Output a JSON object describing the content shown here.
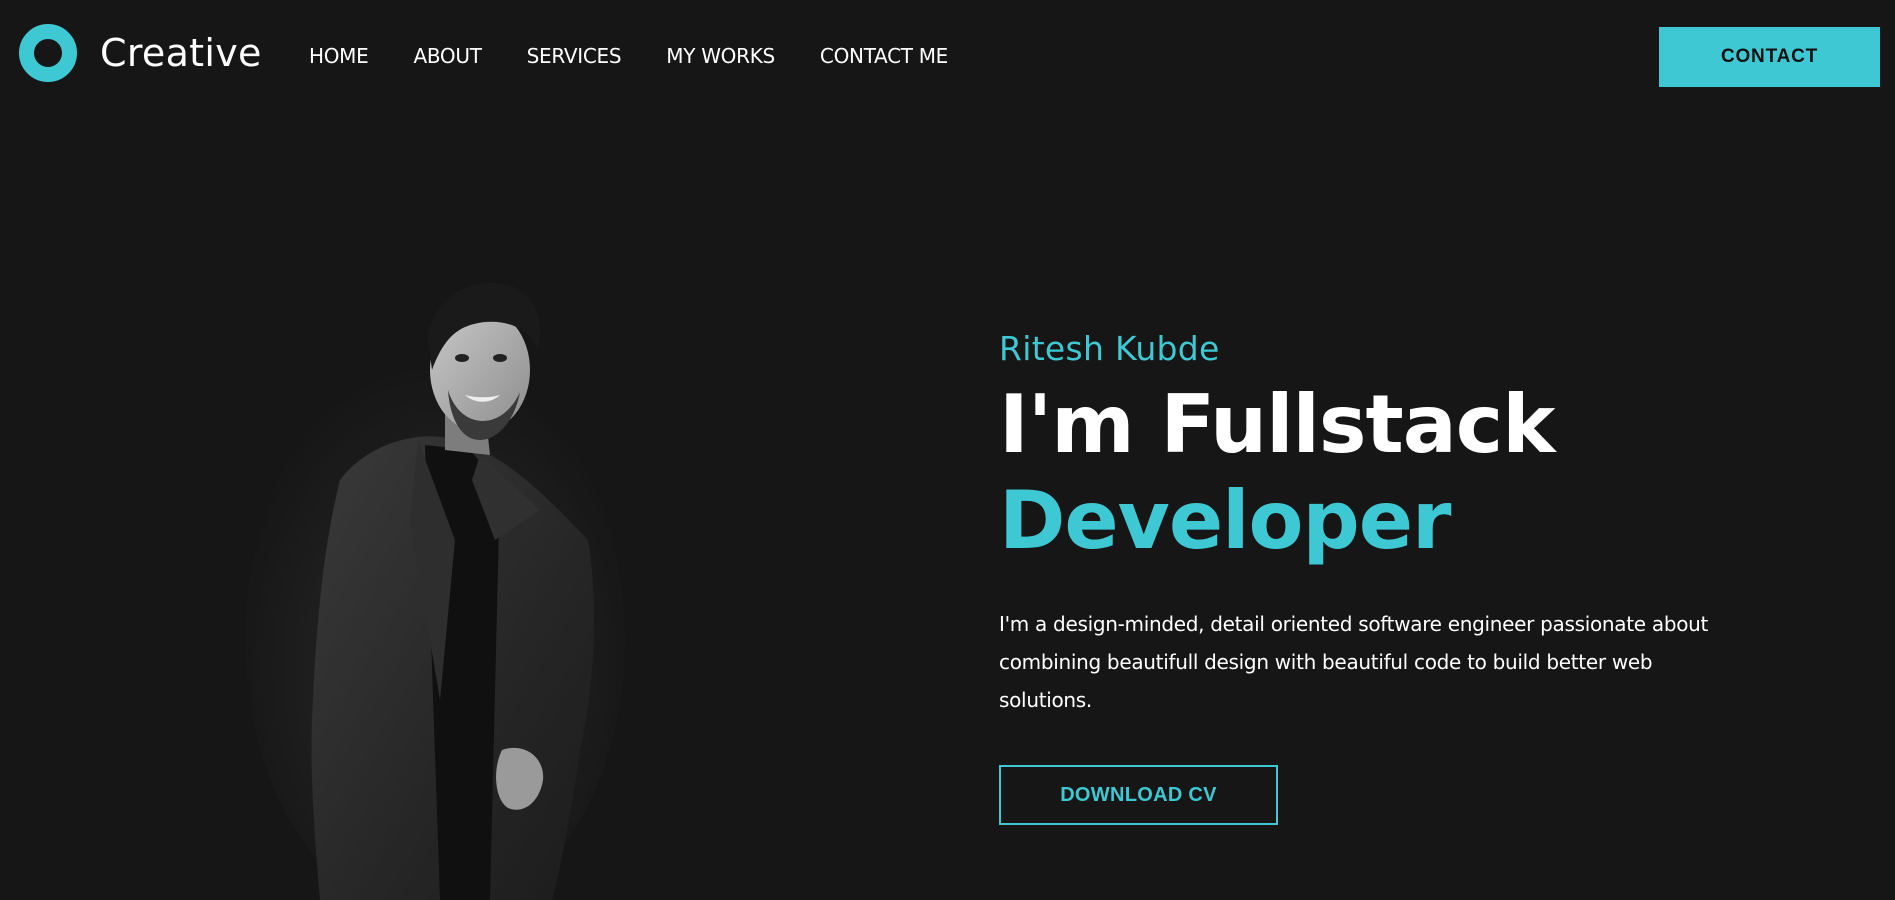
{
  "brand": {
    "name": "Creative",
    "accent_color": "#3ec8d3",
    "background_color": "#161616"
  },
  "nav": {
    "items": [
      {
        "label": "HOME"
      },
      {
        "label": "ABOUT"
      },
      {
        "label": "SERVICES"
      },
      {
        "label": "MY WORKS"
      },
      {
        "label": "CONTACT ME"
      }
    ],
    "contact_button": "CONTACT"
  },
  "hero": {
    "name": "Ritesh Kubde",
    "title_line1": "I'm Fullstack",
    "title_line2": "Developer",
    "description": "I'm a design-minded, detail oriented software engineer passionate about combining beautifull design with beautiful code to build better web solutions.",
    "download_button": "DOWNLOAD CV",
    "portrait_icon": "person-portrait-photo"
  }
}
